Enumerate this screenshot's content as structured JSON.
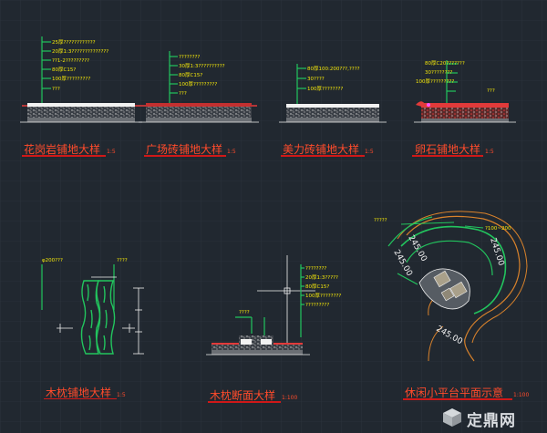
{
  "colors": {
    "background": "#212830",
    "grid": "#2c343d",
    "leader": "#22c55e",
    "annotation": "#f4e70a",
    "title": "#ff4b2b",
    "title_underline": "#d01818",
    "paving_red": "#e23a3a",
    "orange_dim": "#d9822b",
    "white": "#f2f2f2"
  },
  "drawings": [
    {
      "id": "granite",
      "title": "花岗岩铺地大样",
      "scale": "1:5",
      "labels": [
        "25厚????????????",
        "20厚1:3??????????????",
        "??1-2?????????",
        "80厚C15?",
        "100厚?????????",
        "???"
      ]
    },
    {
      "id": "plaza-brick",
      "title": "广场砖铺地大样",
      "scale": "1:5",
      "labels": [
        "????????",
        "30厚1:3??????????",
        "80厚C15?",
        "100厚?????????",
        "???"
      ]
    },
    {
      "id": "meili-brick",
      "title": "美力砖铺地大样",
      "scale": "1:5",
      "labels": [
        "80厚100:200???,????",
        "30????",
        "100厚????????"
      ]
    },
    {
      "id": "pebble",
      "title": "卵石铺地大样",
      "scale": "1:5",
      "labels": [
        "80厚C20???????",
        "30????????",
        "100厚?????????",
        "???"
      ]
    },
    {
      "id": "log-paving",
      "title": "木枕铺地大样",
      "scale": "1:5",
      "labels": [
        "φ200???",
        "????"
      ]
    },
    {
      "id": "log-section",
      "title": "木枕断面大样",
      "scale": "1:100",
      "labels": [
        "????????",
        "20厚1:3?????",
        "80厚C15?",
        "100厚????????",
        "?????????",
        "????"
      ]
    },
    {
      "id": "platform-plan",
      "title": "休闲小平台平面示意",
      "scale": "1:100",
      "labels": [
        "?????",
        "?100~200",
        "245.00",
        "245.00",
        "245.00",
        "245.00"
      ]
    }
  ],
  "watermark": {
    "text": "定鼎网",
    "logo": "cube-logo-icon"
  }
}
